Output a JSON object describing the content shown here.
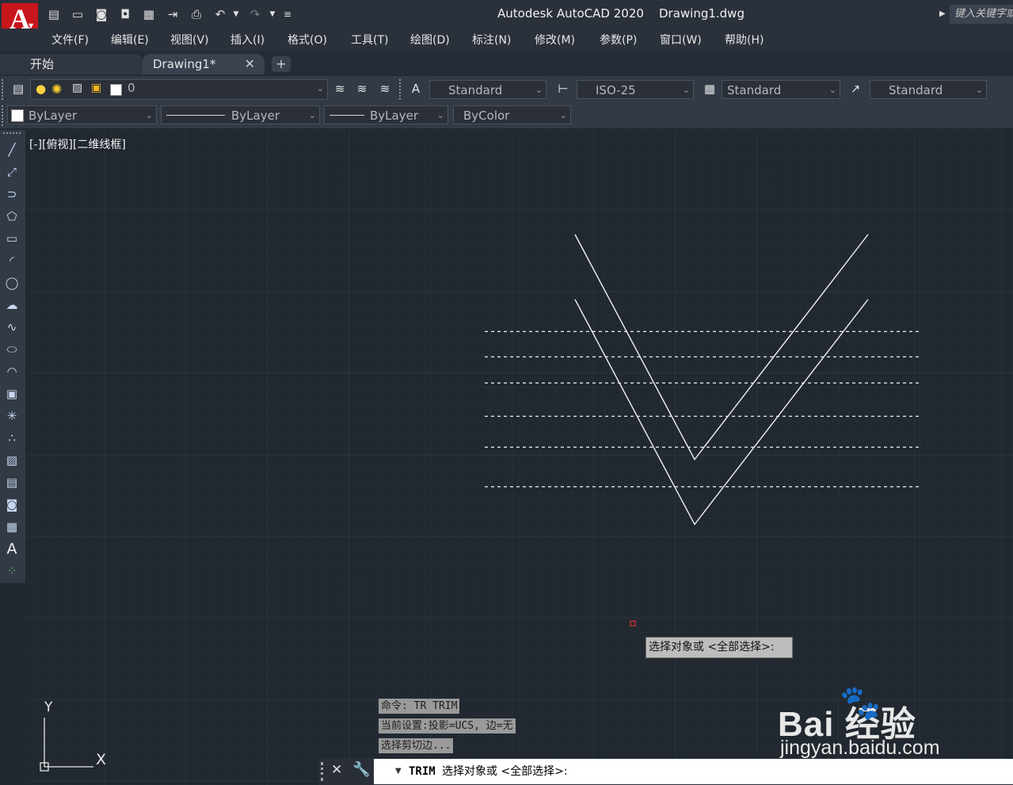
{
  "app": {
    "logo_letter": "A",
    "title": "Autodesk AutoCAD 2020    Drawing1.dwg",
    "search_placeholder": "键入关键字或"
  },
  "menu": [
    "文件(F)",
    "编辑(E)",
    "视图(V)",
    "插入(I)",
    "格式(O)",
    "工具(T)",
    "绘图(D)",
    "标注(N)",
    "修改(M)",
    "参数(P)",
    "窗口(W)",
    "帮助(H)"
  ],
  "tabs": {
    "start": "开始",
    "drawing": "Drawing1*",
    "close": "✕",
    "add": "+"
  },
  "toolbar1": {
    "layer": "0",
    "text_style": "Standard",
    "dim_style": "ISO-25",
    "table_style": "Standard",
    "mleader_style": "Standard"
  },
  "toolbar2": {
    "color": "ByLayer",
    "linetype": "ByLayer",
    "lineweight": "ByLayer",
    "plotstyle": "ByColor"
  },
  "viewport": {
    "label": "[-][俯视][二维线框]",
    "ucs_y": "Y",
    "ucs_x": "X"
  },
  "command": {
    "history": [
      "命令: TR TRIM",
      "当前设置:投影=UCS, 边=无",
      "选择剪切边..."
    ],
    "tooltip": "选择对象或 <全部选择>:",
    "prompt_cmd": "TRIM",
    "prompt_text": "选择对象或 <全部选择>:"
  },
  "watermark": {
    "logo": "Bai 经验",
    "url": "jingyan.baidu.com"
  },
  "colors": {
    "canvas": "#212830",
    "grid_minor": "#2a313b",
    "grid_major": "#333b47",
    "drawing_lines": "#f2f2f2",
    "accent_red": "#c8161d"
  }
}
